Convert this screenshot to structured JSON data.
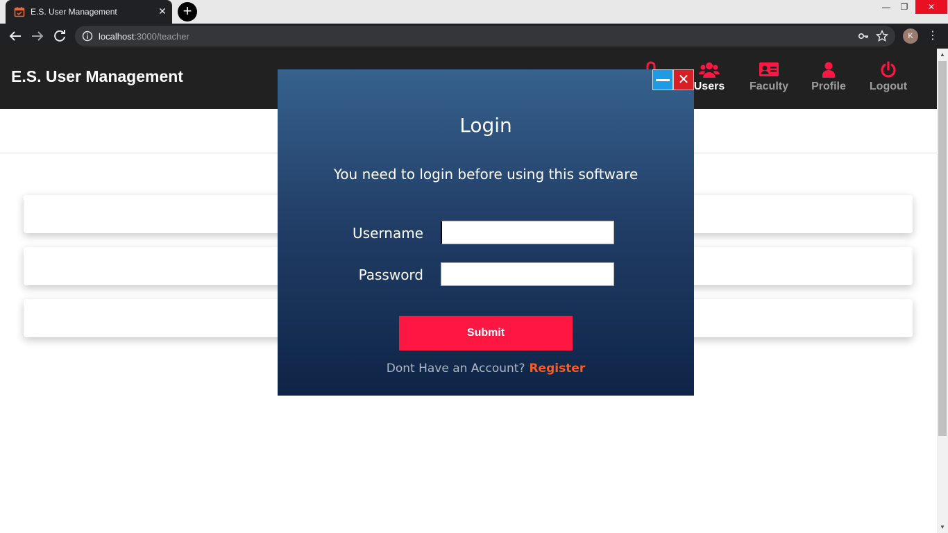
{
  "browser": {
    "tab_title": "E.S. User Management",
    "tab_close": "✕",
    "new_tab": "+",
    "url_host": "localhost",
    "url_path": ":3000/teacher",
    "profile_initial": "K",
    "window_controls": {
      "minimize": "—",
      "maximize": "❐",
      "close": "✕"
    }
  },
  "app": {
    "brand": "E.S. User Management",
    "nav": [
      {
        "label": "Users",
        "icon": "users-icon",
        "active": true
      },
      {
        "label": "Faculty",
        "icon": "id-card-icon",
        "active": false
      },
      {
        "label": "Profile",
        "icon": "person-icon",
        "active": false
      },
      {
        "label": "Logout",
        "icon": "power-icon",
        "active": false
      }
    ],
    "accent_color": "#ff1744"
  },
  "login_modal": {
    "title": "Login",
    "subtitle": "You need to login before using this software",
    "username_label": "Username",
    "password_label": "Password",
    "username_value": "",
    "password_value": "",
    "submit_label": "Submit",
    "register_prompt": "Dont Have an Account?",
    "register_link": "Register",
    "close_glyph": "✕"
  }
}
